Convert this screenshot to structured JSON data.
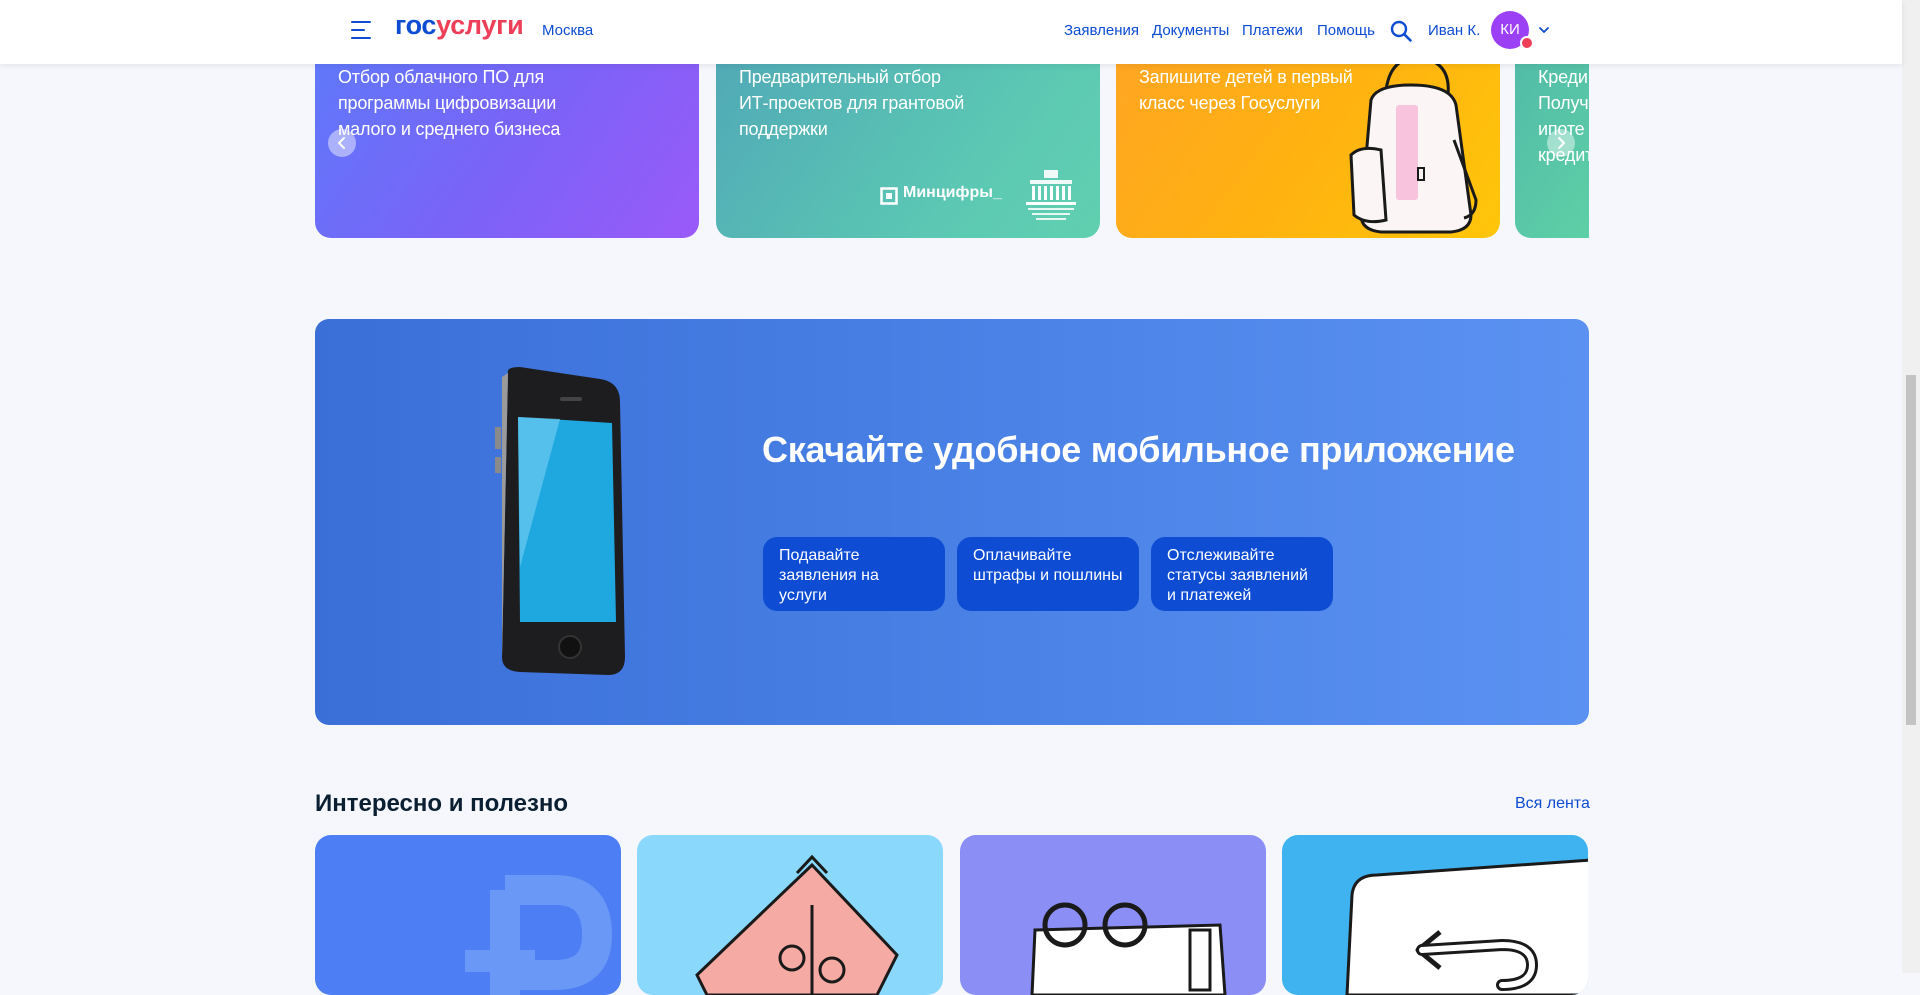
{
  "header": {
    "logo_part1": "гос",
    "logo_part2": "услуги",
    "city": "Москва",
    "nav": [
      "Заявления",
      "Документы",
      "Платежи",
      "Помощь"
    ],
    "user_name": "Иван К.",
    "avatar_initials": "КИ"
  },
  "carousel": {
    "cards": [
      {
        "text": "Отбор облачного ПО для\nпрограммы цифровизации\nмалого и среднего бизнеса"
      },
      {
        "text": "Предварительный отбор\nИТ-проектов для грантовой\nподдержки",
        "logo_text": "Минцифры_"
      },
      {
        "text": "Запишите детей в первый\nкласс через Госуслуги"
      },
      {
        "text": "Креди\nПолуч\nипоте\nкредит"
      }
    ]
  },
  "promo": {
    "title": "Скачайте удобное мобильное приложение",
    "features": [
      "Подавайте\nзаявления на услуги",
      "Оплачивайте\nштрафы и пошлины",
      "Отслеживайте\nстатусы заявлений\nи платежей"
    ]
  },
  "feed": {
    "title": "Интересно и полезно",
    "all_link": "Вся лента"
  },
  "colors": {
    "brand_blue": "#0d4cd3",
    "brand_red": "#ee3f58",
    "avatar": "#9c40f5"
  }
}
